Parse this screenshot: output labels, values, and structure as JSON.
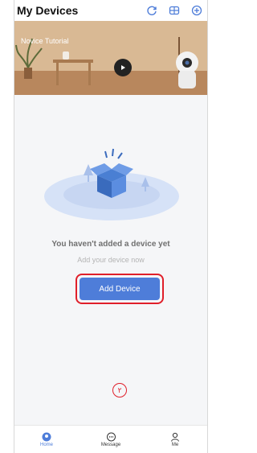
{
  "header": {
    "title": "My Devices"
  },
  "banner": {
    "label": "Novice Tutorial"
  },
  "empty_state": {
    "title": "You haven't added a device yet",
    "subtitle": "Add your device now",
    "button_label": "Add Device"
  },
  "annotation": {
    "step": "٢"
  },
  "tabbar": {
    "items": [
      {
        "label": "Home",
        "icon": "home-icon",
        "active": true
      },
      {
        "label": "Message",
        "icon": "message-icon",
        "active": false
      },
      {
        "label": "Me",
        "icon": "person-icon",
        "active": false
      }
    ]
  },
  "colors": {
    "accent": "#4e7dd9",
    "highlight": "#e01f2a",
    "background": "#f5f6f8"
  }
}
